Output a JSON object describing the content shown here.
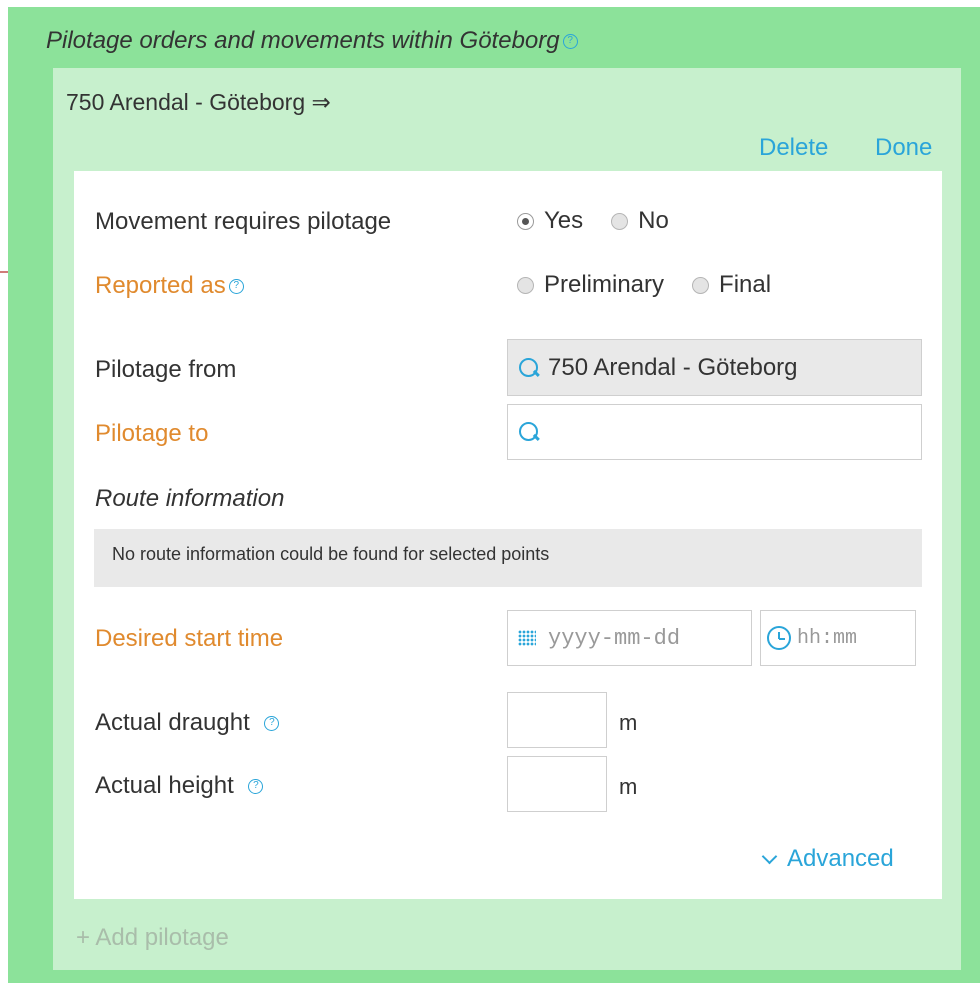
{
  "section": {
    "title": "Pilotage orders and movements within Göteborg",
    "help_icon": "?"
  },
  "movement": {
    "title": "750 Arendal - Göteborg ⇒",
    "delete_label": "Delete",
    "done_label": "Done"
  },
  "form": {
    "requires_pilotage": {
      "label": "Movement requires pilotage",
      "options": [
        "Yes",
        "No"
      ],
      "selected": "Yes"
    },
    "reported_as": {
      "label": "Reported as",
      "options": [
        "Preliminary",
        "Final"
      ],
      "selected": null
    },
    "pilotage_from": {
      "label": "Pilotage from",
      "value": "750 Arendal - Göteborg"
    },
    "pilotage_to": {
      "label": "Pilotage to",
      "value": ""
    },
    "route_information": {
      "label": "Route information",
      "message": "No route information could be found for selected points"
    },
    "desired_start_time": {
      "label": "Desired start time",
      "date_placeholder": "yyyy-mm-dd",
      "time_placeholder": "hh:mm"
    },
    "actual_draught": {
      "label": "Actual draught",
      "value": "",
      "unit": "m"
    },
    "actual_height": {
      "label": "Actual height",
      "value": "",
      "unit": "m"
    },
    "advanced_label": "Advanced"
  },
  "add_pilotage_label": "+ Add pilotage",
  "colors": {
    "outer_bg": "#8ce29a",
    "inner_bg": "#c7f0cd",
    "accent_blue": "#2aa5d9",
    "required_orange": "#e08a2e",
    "annotation_arrow": "#c0504d"
  }
}
